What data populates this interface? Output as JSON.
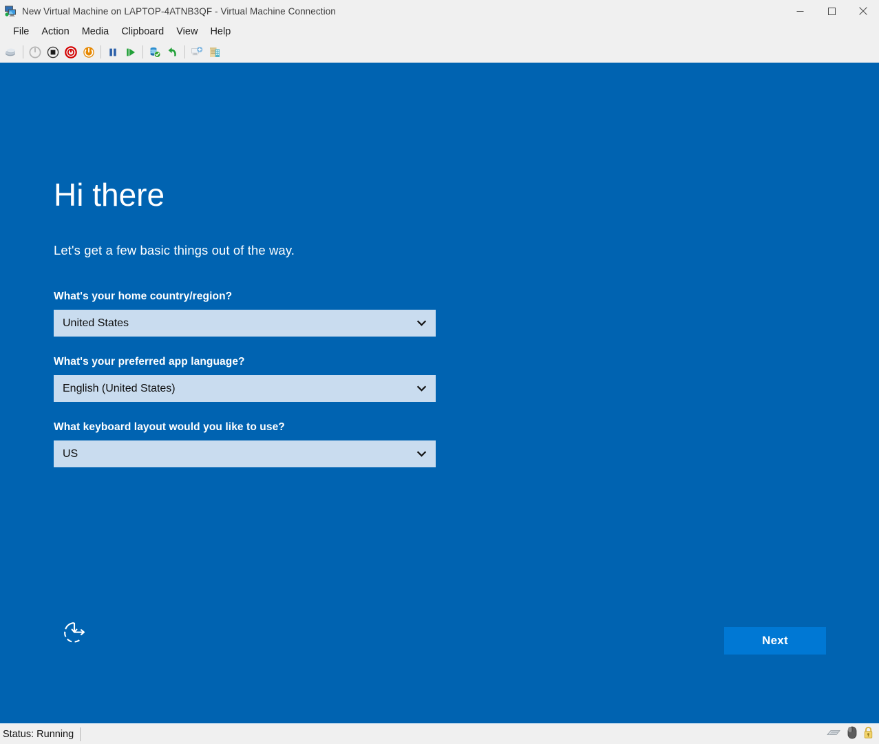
{
  "window": {
    "title": "New Virtual Machine on LAPTOP-4ATNB3QF - Virtual Machine Connection",
    "icon": "virtual-machine-icon",
    "controls": {
      "minimize": "minimize-icon",
      "maximize": "maximize-icon",
      "close": "close-icon"
    }
  },
  "menu": {
    "items": [
      {
        "label": "File"
      },
      {
        "label": "Action"
      },
      {
        "label": "Media"
      },
      {
        "label": "Clipboard"
      },
      {
        "label": "View"
      },
      {
        "label": "Help"
      }
    ]
  },
  "toolbar": {
    "buttons": [
      {
        "icon": "ctrl-alt-delete-icon",
        "tooltip": "Ctrl+Alt+Delete"
      },
      {
        "icon": "start-icon",
        "tooltip": "Start"
      },
      {
        "icon": "turn-off-icon",
        "tooltip": "Turn Off"
      },
      {
        "icon": "shut-down-icon",
        "tooltip": "Shut Down"
      },
      {
        "icon": "save-icon",
        "tooltip": "Save"
      },
      {
        "icon": "pause-icon",
        "tooltip": "Pause"
      },
      {
        "icon": "reset-icon",
        "tooltip": "Reset"
      },
      {
        "icon": "checkpoint-icon",
        "tooltip": "Checkpoint"
      },
      {
        "icon": "revert-icon",
        "tooltip": "Revert"
      },
      {
        "icon": "enhanced-session-icon",
        "tooltip": "Enhanced Session"
      },
      {
        "icon": "settings-icon",
        "tooltip": "Settings"
      }
    ]
  },
  "oobe": {
    "title": "Hi there",
    "subtitle": "Let's get a few basic things out of the way.",
    "fields": [
      {
        "label": "What's your home country/region?",
        "value": "United States",
        "name": "country-region-combobox"
      },
      {
        "label": "What's your preferred app language?",
        "value": "English (United States)",
        "name": "app-language-combobox"
      },
      {
        "label": "What keyboard layout would you like to use?",
        "value": "US",
        "name": "keyboard-layout-combobox"
      }
    ],
    "ease_of_access": {
      "icon": "ease-of-access-icon",
      "label": "Ease of Access"
    },
    "next_button": {
      "label": "Next"
    },
    "colors": {
      "background": "#0063b1",
      "combo_background": "#c9dcef",
      "accent_button": "#0078d4",
      "text": "#ffffff"
    }
  },
  "status_bar": {
    "status_text": "Status: Running",
    "icons": [
      {
        "name": "keyboard-icon"
      },
      {
        "name": "mouse-icon"
      },
      {
        "name": "lock-icon"
      }
    ]
  }
}
